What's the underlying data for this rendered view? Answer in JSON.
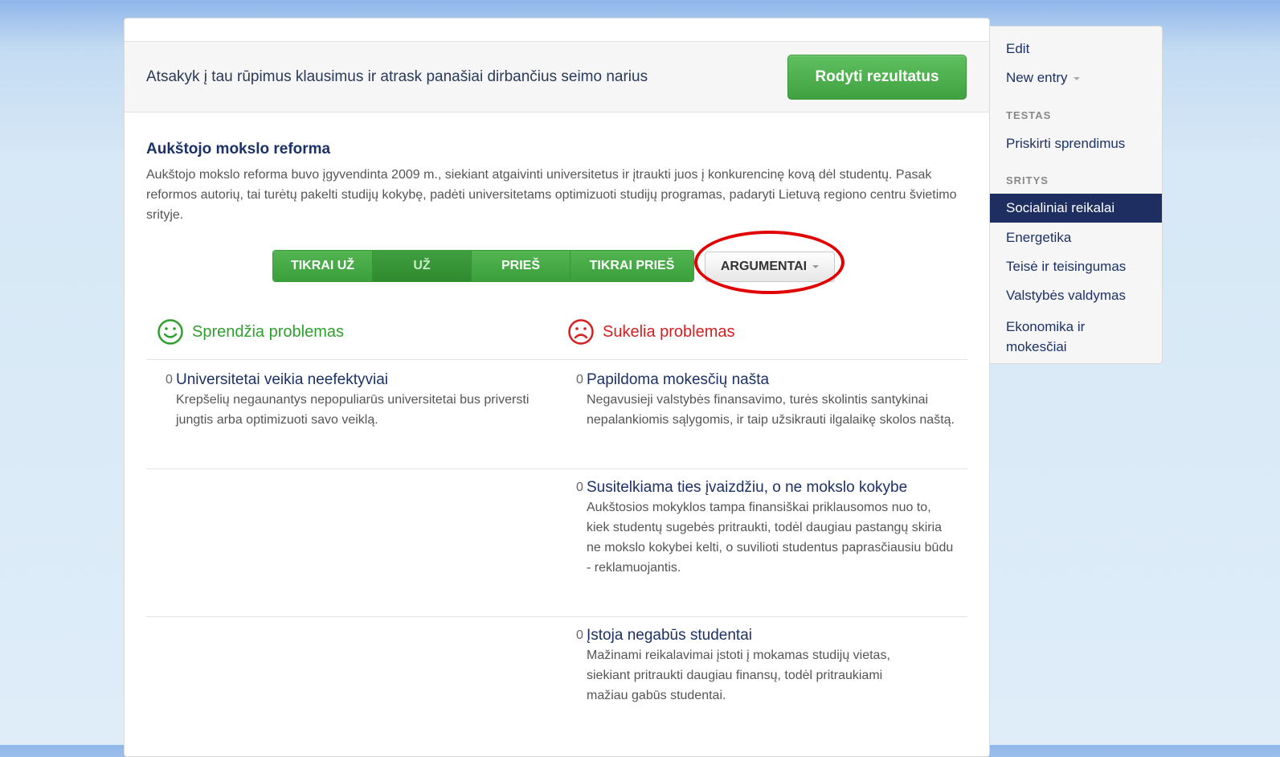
{
  "banner": {
    "text": "Atsakyk į tau rūpimus klausimus ir atrask panašiai dirbančius seimo narius",
    "results_button": "Rodyti rezultatus"
  },
  "topic": {
    "title": "Aukštojo mokslo reforma",
    "description": "Aukštojo mokslo reforma buvo įgyvendinta 2009 m., siekiant atgaivinti universitetus ir įtraukti juos į konkurencinę kovą dėl studentų. Pasak reformos autorių, tai turėtų pakelti studijų kokybę, padėti universitetams optimizuoti studijų programas, padaryti Lietuvą regiono centru švietimo srityje."
  },
  "vote": {
    "options": [
      "TIKRAI UŽ",
      "UŽ",
      "PRIEŠ",
      "TIKRAI PRIEŠ"
    ],
    "selected": "UŽ",
    "arguments_button": "ARGUMENTAI"
  },
  "columns": {
    "positive_heading": "Sprendžia problemas",
    "negative_heading": "Sukelia problemas"
  },
  "positive_arguments": [
    {
      "count": "0",
      "title": "Universitetai veikia neefektyviai",
      "description": "Krepšelių negaunantys nepopuliarūs universitetai bus priversti jungtis arba optimizuoti savo veiklą."
    }
  ],
  "negative_arguments": [
    {
      "count": "0",
      "title": "Papildoma mokesčių našta",
      "description": "Negavusieji valstybės finansavimo, turės skolintis santykinai nepalankiomis sąlygomis, ir taip užsikrauti ilgalaikę skolos naštą."
    },
    {
      "count": "0",
      "title": "Susitelkiama ties įvaizdžiu, o ne mokslo kokybe",
      "description": "Aukštosios mokyklos tampa finansiškai priklausomos nuo to, kiek studentų sugebės pritraukti, todėl daugiau pastangų skiria ne mokslo kokybei kelti, o suvilioti studentus paprasčiausiu būdu - reklamuojantis."
    },
    {
      "count": "0",
      "title": "Įstoja negabūs studentai",
      "description": "Mažinami reikalavimai įstoti į mokamas studijų vietas, siekiant pritraukti daugiau finansų, todėl pritraukiami mažiau gabūs studentai."
    }
  ],
  "sidebar": {
    "edit": "Edit",
    "new_entry": "New entry",
    "section_testas": "TESTAS",
    "priskirti": "Priskirti sprendimus",
    "section_sritys": "SRITYS",
    "areas": [
      "Socialiniai reikalai",
      "Energetika",
      "Teisė ir teisingumas",
      "Valstybės valdymas",
      "Ekonomika ir mokesčiai"
    ],
    "active_area": "Socialiniai reikalai"
  },
  "colors": {
    "green": "#3fa13f",
    "red": "#d42020",
    "navy": "#1c3168",
    "highlight_ring": "#e00000"
  },
  "icons": {
    "positive": "smile-icon",
    "negative": "frown-icon"
  }
}
